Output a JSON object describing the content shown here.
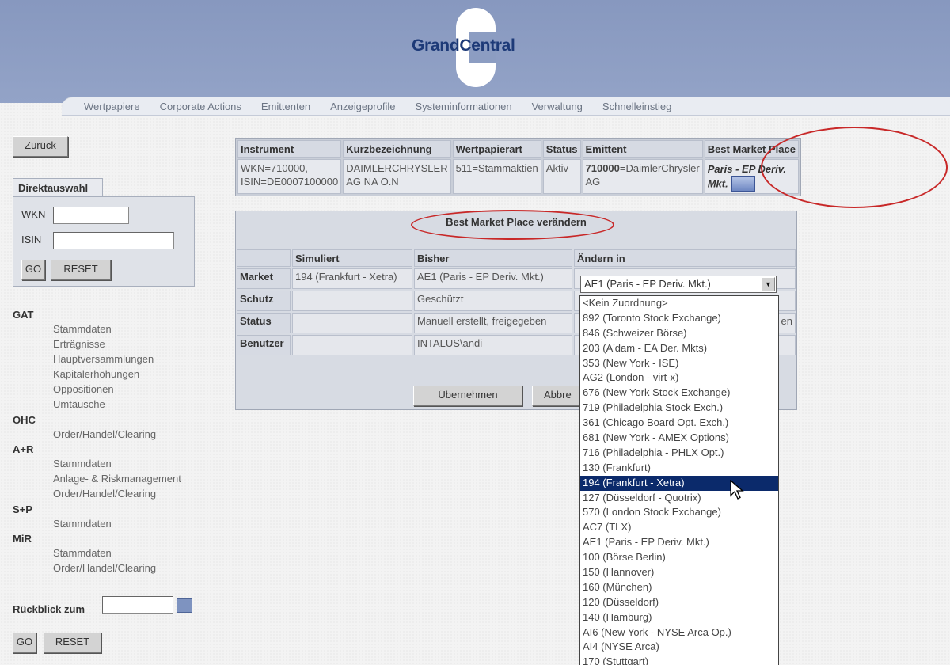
{
  "header": {
    "logo_text": "GrandCentral",
    "nav": [
      "Wertpapiere",
      "Corporate Actions",
      "Emittenten",
      "Anzeigeprofile",
      "Systeminformationen",
      "Verwaltung",
      "Schnelleinstieg"
    ]
  },
  "sidebar": {
    "back_label": "Zurück",
    "direkt_tab": "Direktauswahl",
    "wkn_label": "WKN",
    "isin_label": "ISIN",
    "wkn_value": "",
    "isin_value": "",
    "go_label": "GO",
    "reset_label": "RESET",
    "sections": [
      {
        "title": "GAT",
        "links": [
          "Stammdaten",
          "Erträgnisse",
          "Hauptversammlungen",
          "Kapitalerhöhungen",
          "Oppositionen",
          "Umtäusche"
        ]
      },
      {
        "title": "OHC",
        "links": [
          "Order/Handel/Clearing"
        ]
      },
      {
        "title": "A+R",
        "links": [
          "Stammdaten",
          "Anlage- & Riskmanagement",
          "Order/Handel/Clearing"
        ]
      },
      {
        "title": "S+P",
        "links": [
          "Stammdaten"
        ]
      },
      {
        "title": "MiR",
        "links": [
          "Stammdaten",
          "Order/Handel/Clearing"
        ]
      }
    ],
    "rueckblick_label": "Rückblick zum",
    "rueckblick_value": ""
  },
  "info_table": {
    "headers": [
      "Instrument",
      "Kurzbezeichnung",
      "Wertpapierart",
      "Status",
      "Emittent",
      "Best Market Place"
    ],
    "instrument": [
      "WKN=710000,",
      "ISIN=DE0007100000"
    ],
    "kurz": [
      "DAIMLERCHRYSLER",
      "AG NA O.N"
    ],
    "art": "511=Stammaktien",
    "status": "Aktiv",
    "emittent_code": "710000",
    "emittent_rest": "=DaimlerChrysler AG",
    "best_market_place": "Paris - EP Deriv. Mkt."
  },
  "change": {
    "title": "Best Market Place verändern",
    "headers": [
      "",
      "Simuliert",
      "Bisher",
      "Ändern in"
    ],
    "rows": [
      {
        "label": "Market",
        "simuliert": "194 (Frankfurt - Xetra)",
        "bisher": "AE1 (Paris - EP Deriv. Mkt.)",
        "aendern": ""
      },
      {
        "label": "Schutz",
        "simuliert": "",
        "bisher": "Geschützt",
        "aendern": ""
      },
      {
        "label": "Status",
        "simuliert": "",
        "bisher": "Manuell erstellt, freigegeben",
        "aendern": "en"
      },
      {
        "label": "Benutzer",
        "simuliert": "",
        "bisher": "INTALUS\\andi",
        "aendern": ""
      }
    ],
    "select_value": "AE1 (Paris - EP Deriv. Mkt.)",
    "apply_label": "Übernehmen",
    "cancel_label": "Abbre",
    "dropdown_options": [
      "<Kein Zuordnung>",
      "892 (Toronto Stock Exchange)",
      "846 (Schweizer Börse)",
      "203 (A'dam - EA Der. Mkts)",
      "353 (New York - ISE)",
      "AG2 (London - virt-x)",
      "676 (New York Stock Exchange)",
      "719 (Philadelphia Stock Exch.)",
      "361 (Chicago Board Opt. Exch.)",
      "681 (New York - AMEX Options)",
      "716 (Philadelphia - PHLX Opt.)",
      "130 (Frankfurt)",
      "194 (Frankfurt - Xetra)",
      "127 (Düsseldorf - Quotrix)",
      "570 (London Stock Exchange)",
      "AC7 (TLX)",
      "AE1 (Paris - EP Deriv. Mkt.)",
      "100 (Börse Berlin)",
      "150 (Hannover)",
      "160 (München)",
      "120 (Düsseldorf)",
      "140 (Hamburg)",
      "AI6 (New York - NYSE Arca Op.)",
      "AI4 (NYSE Arca)",
      "170 (Stuttgart)"
    ],
    "dropdown_selected_index": 12
  },
  "colors": {
    "header_bg": "#8c9dc2",
    "logo_blue": "#1d3a78",
    "highlight_ellipse": "#c82828",
    "selected_option": "#0b2a6b"
  }
}
